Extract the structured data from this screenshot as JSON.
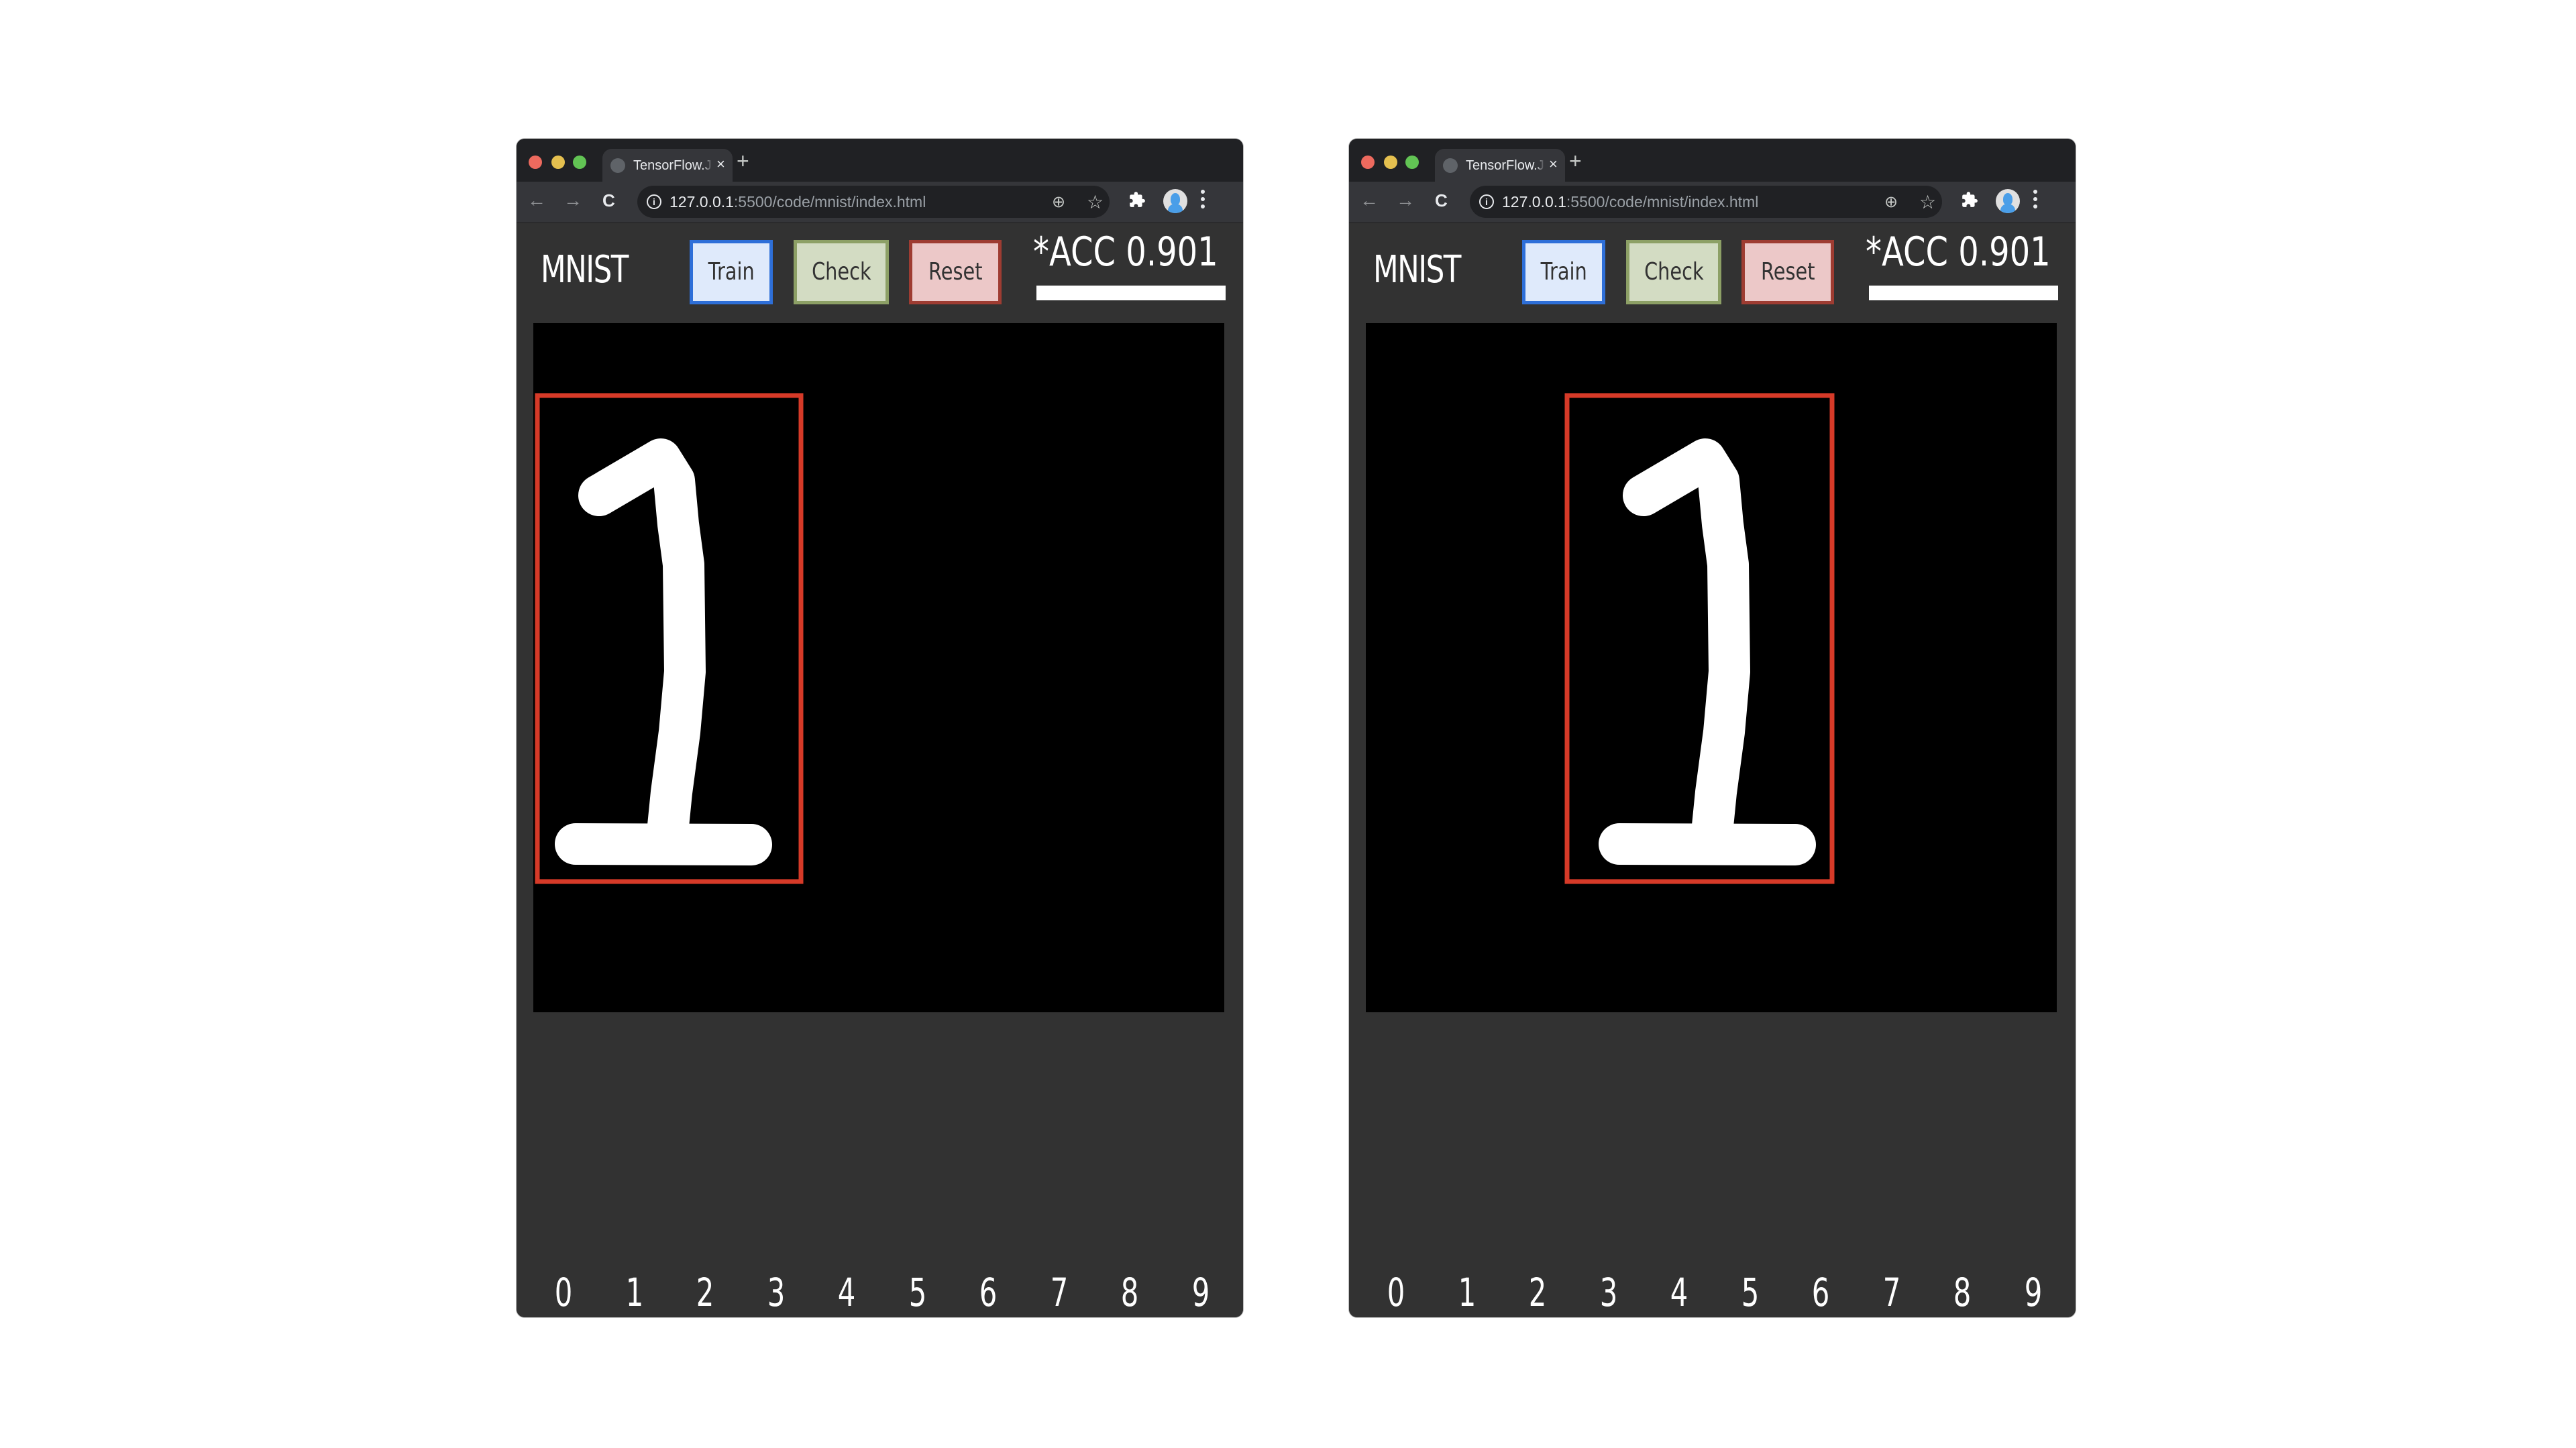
{
  "windows": [
    {
      "id": "left",
      "tab": {
        "title": "TensorFlow.JS MNIST Workshop",
        "close": "×"
      },
      "newtab": "+",
      "url": {
        "host": "127.0.0.1",
        "rest": ":5500/code/mnist/index.html"
      },
      "app": {
        "logo": "MNIST",
        "buttons": {
          "train": "Train",
          "check": "Check",
          "reset": "Reset"
        },
        "accuracy_label": "*ACC 0.901",
        "accuracy_value": 0.901,
        "accuracy_bar_fraction": 1.0,
        "drawn_digit": "1",
        "bounding_box_color": "#d63a28",
        "bounding_box_position": "left"
      },
      "digits": [
        "0",
        "1",
        "2",
        "3",
        "4",
        "5",
        "6",
        "7",
        "8",
        "9"
      ]
    },
    {
      "id": "right",
      "tab": {
        "title": "TensorFlow.JS MNIST Workshop",
        "close": "×"
      },
      "newtab": "+",
      "url": {
        "host": "127.0.0.1",
        "rest": ":5500/code/mnist/index.html"
      },
      "app": {
        "logo": "MNIST",
        "buttons": {
          "train": "Train",
          "check": "Check",
          "reset": "Reset"
        },
        "accuracy_label": "*ACC 0.901",
        "accuracy_value": 0.901,
        "accuracy_bar_fraction": 1.0,
        "drawn_digit": "1",
        "bounding_box_color": "#d63a28",
        "bounding_box_position": "centered"
      },
      "digits": [
        "0",
        "1",
        "2",
        "3",
        "4",
        "5",
        "6",
        "7",
        "8",
        "9"
      ]
    }
  ],
  "icons": {
    "back": "←",
    "forward": "→",
    "reload": "C",
    "info": "i",
    "zoom": "⊕",
    "star": "☆"
  },
  "colors": {
    "train_border": "#2e6fd8",
    "check_border": "#8da066",
    "reset_border": "#9e3c32",
    "box": "#d63a28"
  }
}
